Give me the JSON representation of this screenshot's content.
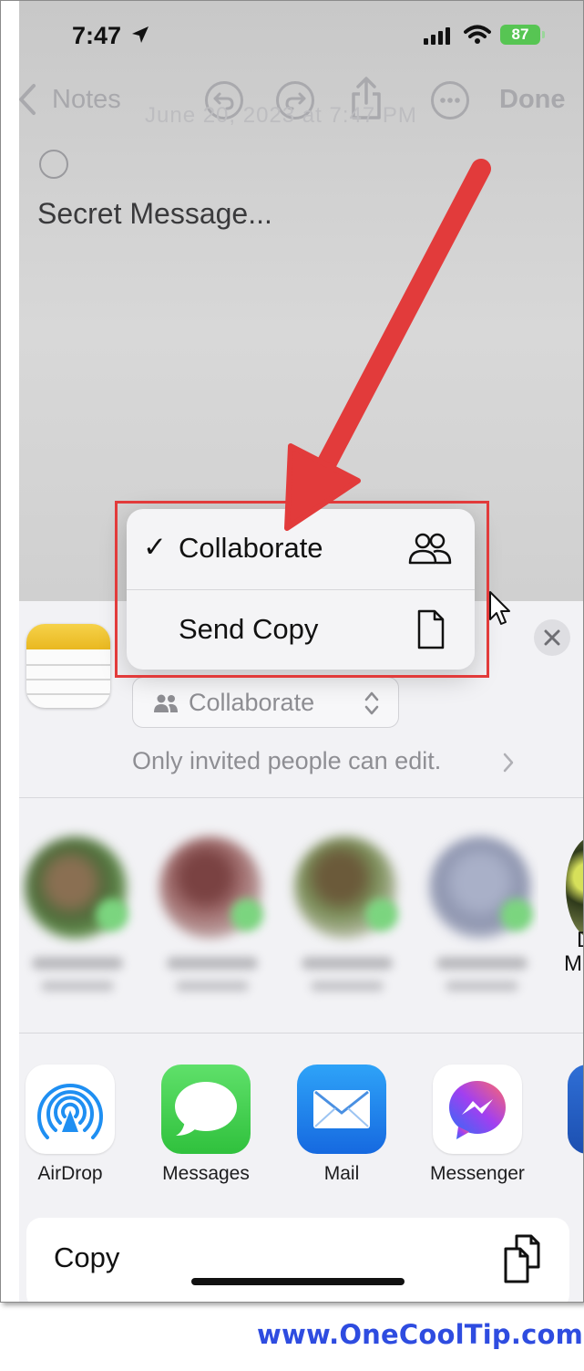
{
  "status_bar": {
    "time": "7:47",
    "battery": "87"
  },
  "note_toolbar": {
    "back_label": "Notes",
    "done_label": "Done",
    "date_ghost": "June 20, 2023 at 7:47 PM"
  },
  "note": {
    "text": "Secret Message..."
  },
  "share_sheet": {
    "collab_select_label": "Collaborate",
    "permission_text": "Only invited people can edit.",
    "partial_contact": {
      "line1": "D",
      "line2": "M"
    },
    "apps": [
      {
        "label": "AirDrop",
        "icon": "airdrop-icon"
      },
      {
        "label": "Messages",
        "icon": "messages-icon"
      },
      {
        "label": "Mail",
        "icon": "mail-icon"
      },
      {
        "label": "Messenger",
        "icon": "messenger-icon"
      }
    ],
    "copy_label": "Copy"
  },
  "menu": {
    "items": [
      {
        "label": "Collaborate",
        "checked": true,
        "check": "✓",
        "icon": "people-icon"
      },
      {
        "label": "Send Copy",
        "checked": false,
        "icon": "document-icon"
      }
    ]
  },
  "watermark": "www.OneCoolTip.com",
  "colors": {
    "accent_arrow": "#e23b3b",
    "highlight_box": "#e23b3b",
    "watermark": "#2e4ce0",
    "battery": "#57c553"
  }
}
